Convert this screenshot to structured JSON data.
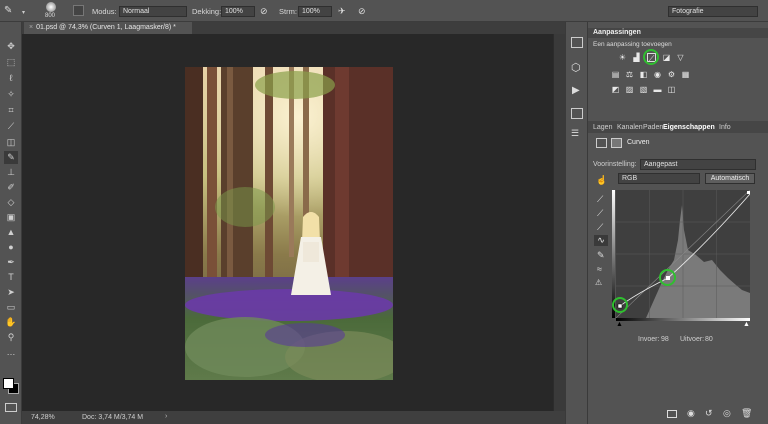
{
  "options_bar": {
    "brush_size": "800",
    "mode_label": "Modus:",
    "mode_value": "Normaal",
    "opacity_label": "Dekking:",
    "opacity_value": "100%",
    "flow_label": "Strm:",
    "flow_value": "100%",
    "workspace": "Fotografie"
  },
  "document": {
    "tab_title": "01.psd @ 74,3% (Curven 1, Laagmasker/8) *"
  },
  "status": {
    "zoom": "74,28%",
    "doc_info": "Doc: 3,74 M/3,74 M"
  },
  "panel": {
    "adjustments_title": "Aanpassingen",
    "adjustments_hint": "Een aanpassing toevoegen",
    "tabs": [
      "Lagen",
      "Kanalen",
      "Paden",
      "Eigenschappen",
      "Info"
    ],
    "properties_title": "Curven",
    "preset_label": "Voorinstelling:",
    "preset_value": "Aangepast",
    "channel_value": "RGB",
    "auto_button": "Automatisch",
    "input_label": "Invoer:",
    "input_value": "98",
    "output_label": "Uitvoer:",
    "output_value": "80"
  },
  "icons": {
    "tools": [
      "move-icon",
      "marquee-icon",
      "lasso-icon",
      "quick-select-icon",
      "crop-icon",
      "eyedropper-icon",
      "healing-icon",
      "brush-icon",
      "clone-stamp-icon",
      "history-brush-icon",
      "eraser-icon",
      "gradient-icon",
      "blur-icon",
      "dodge-icon",
      "pen-icon",
      "type-icon",
      "path-select-icon",
      "rectangle-icon",
      "hand-icon",
      "zoom-icon",
      "more-icon"
    ]
  },
  "colors": {
    "accent_circle": "#2fbf2f",
    "panel_bg": "#535353"
  }
}
